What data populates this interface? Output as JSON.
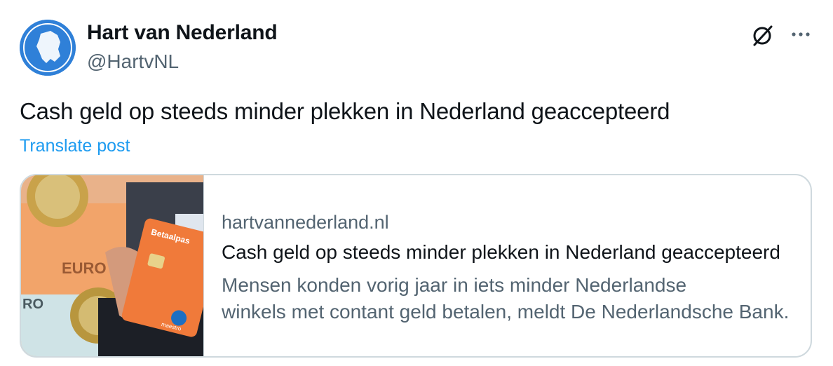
{
  "author": {
    "name": "Hart van Nederland",
    "handle": "@HartvNL",
    "avatar_icon": "netherlands-map-logo"
  },
  "header_icons": {
    "grok": "grok-icon",
    "more": "more-icon"
  },
  "post": {
    "text": "Cash geld op steeds minder plekken in Nederland geaccepteerd",
    "translate_label": "Translate post"
  },
  "card": {
    "domain": "hartvannederland.nl",
    "title": "Cash geld op steeds minder plekken in Nederland geaccepteerd",
    "description_line1": "Mensen konden vorig jaar in iets minder Nederlandse",
    "description_line2": "winkels met contant geld betalen, meldt De Nederlandsche Bank.",
    "thumb_text_euro": "EURO",
    "thumb_text_ro": "RO",
    "thumb_text_card": "Betaalpas",
    "thumb_text_maestro": "maestro"
  },
  "colors": {
    "link": "#1d9bf0",
    "muted": "#536471",
    "border": "#cfd9de",
    "avatar_bg": "#2f80d8"
  }
}
